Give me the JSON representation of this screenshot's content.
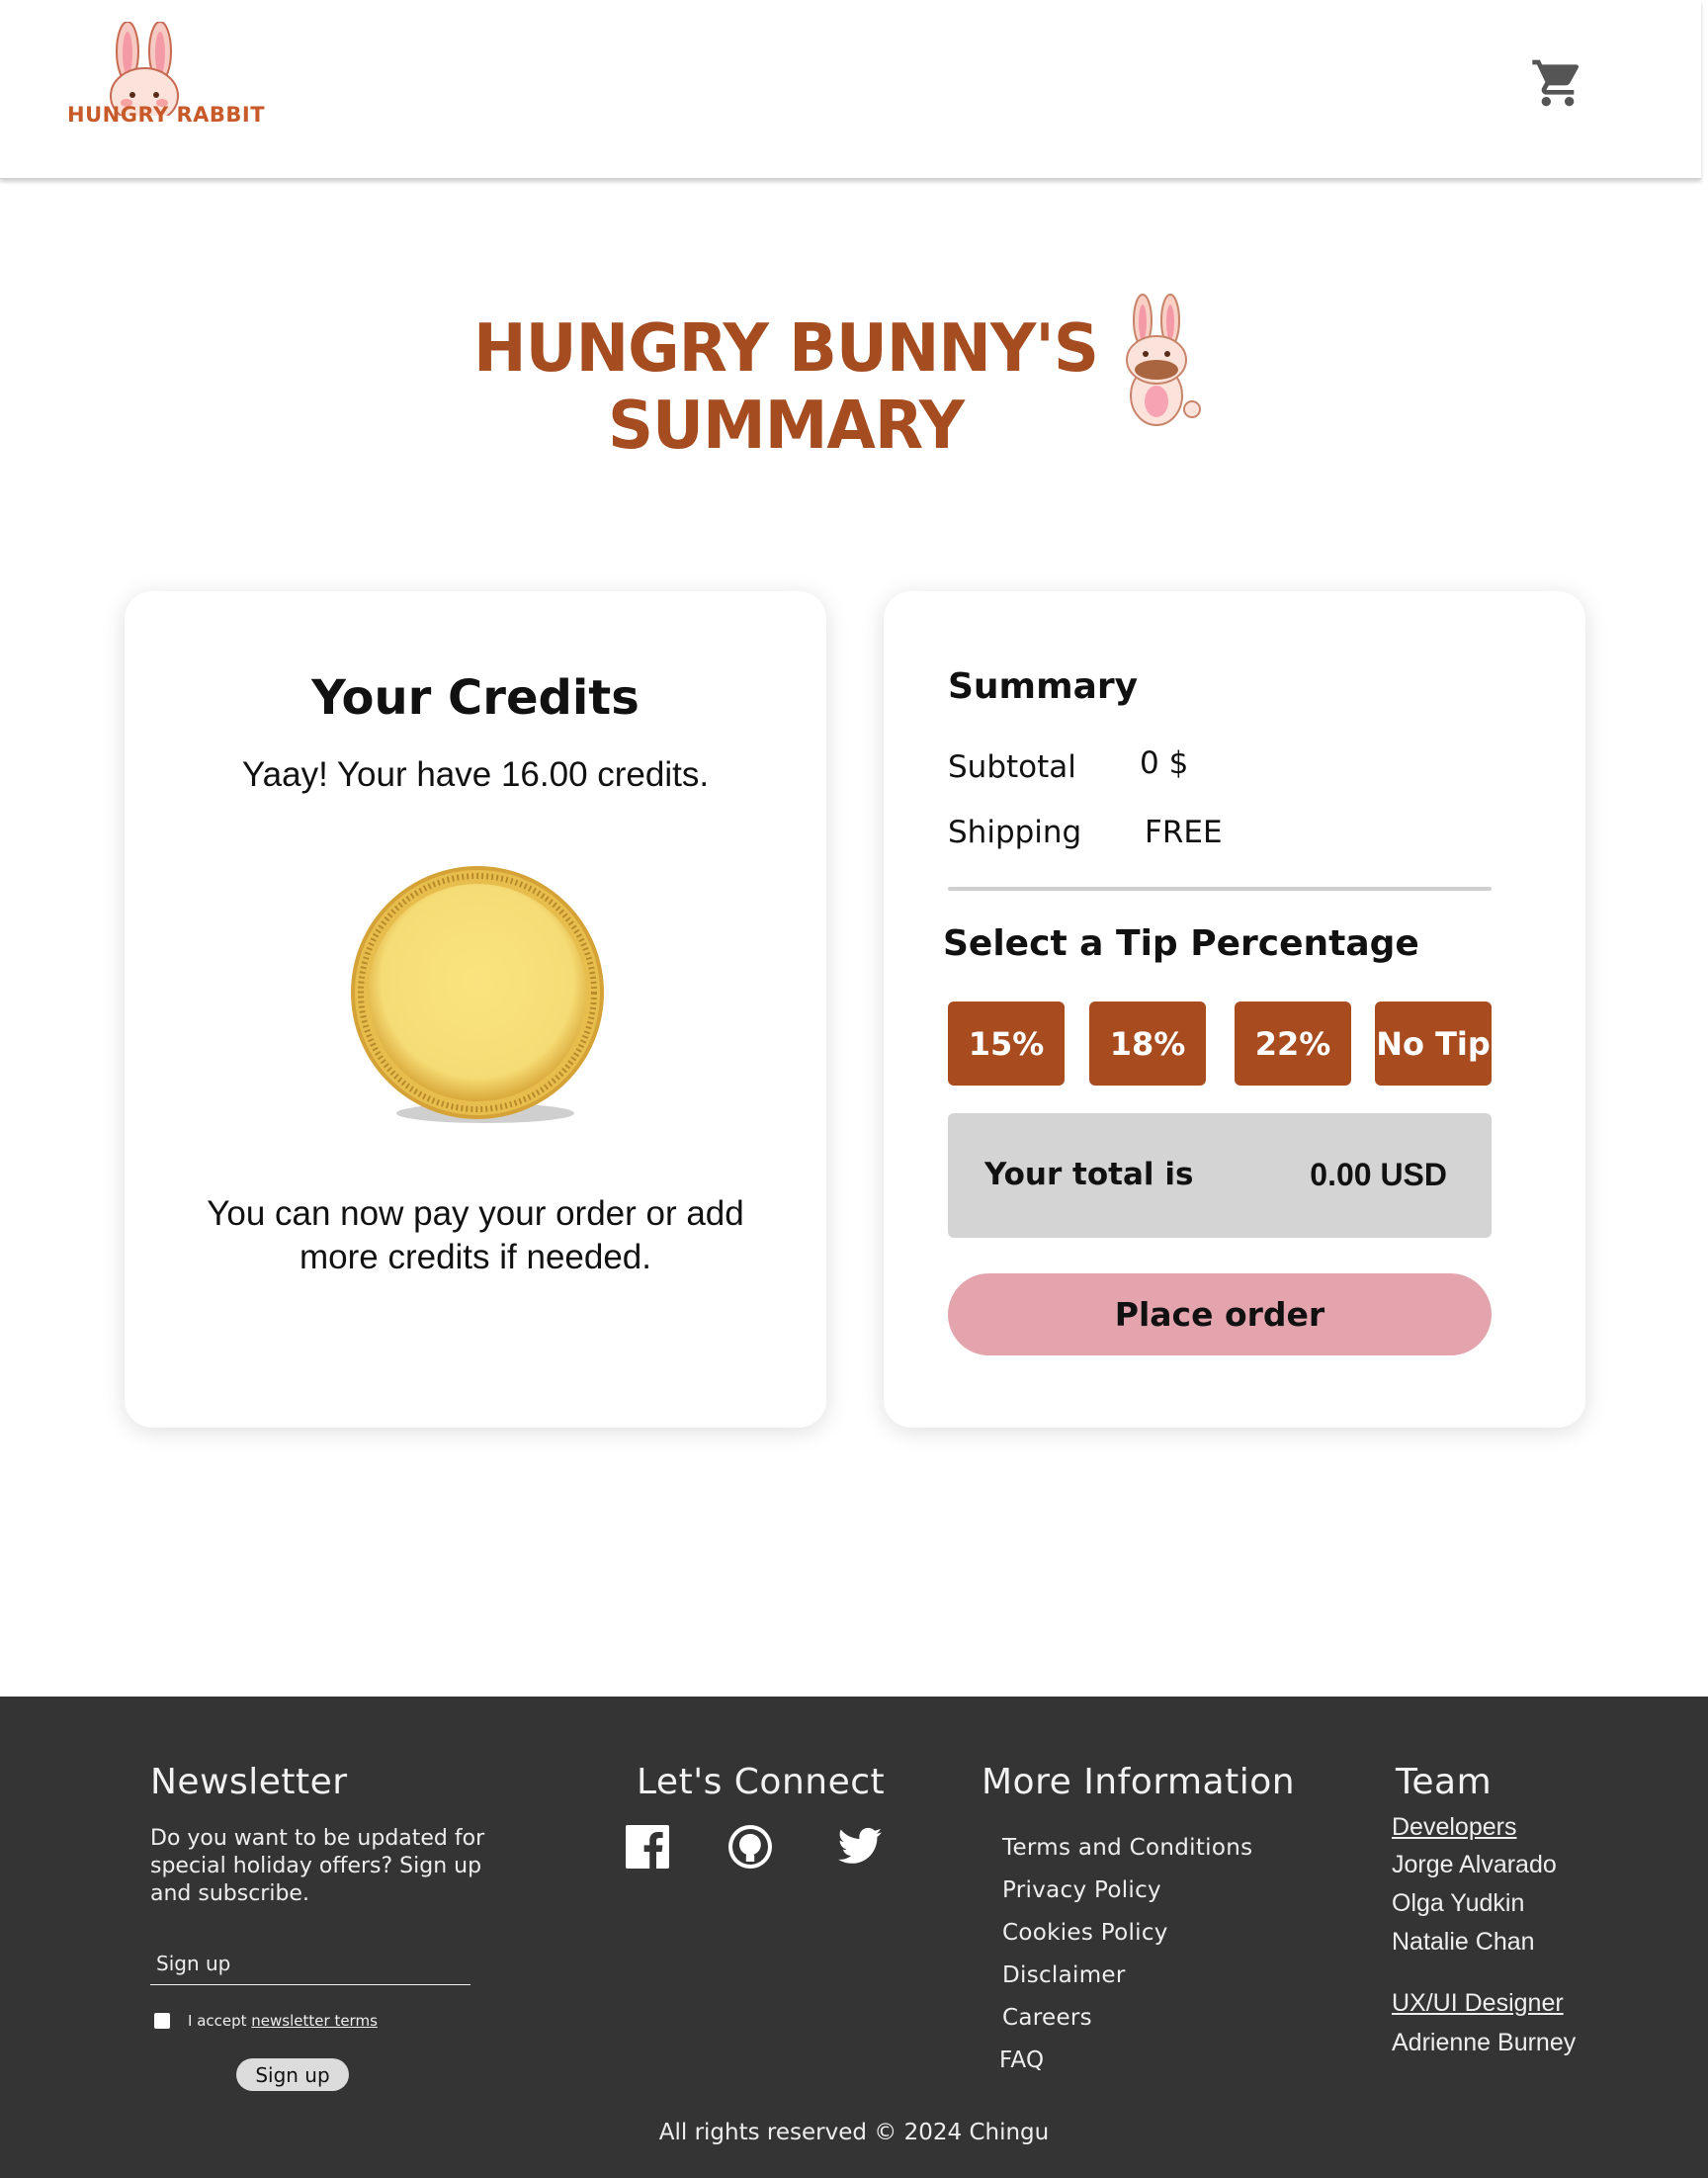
{
  "header": {
    "logo_text": "HUNGRY RABBIT",
    "cart_icon": "shopping-cart-icon"
  },
  "hero": {
    "title_line1": "HUNGRY BUNNY'S",
    "title_line2": "SUMMARY",
    "mascot_icon": "bunny-mascot-icon"
  },
  "credits": {
    "title": "Your Credits",
    "balance_text": "Yaay! Your have 16.00 credits.",
    "coin_icon": "gold-coin-icon",
    "note": "You can now pay your order or add more credits if needed."
  },
  "summary": {
    "title": "Summary",
    "subtotal_label": "Subtotal",
    "subtotal_value": "0 $",
    "shipping_label": "Shipping",
    "shipping_value": "FREE",
    "tip_title": "Select a Tip Percentage",
    "tips": [
      "15%",
      "18%",
      "22%",
      "No Tip"
    ],
    "total_label": "Your total is",
    "total_value": "0.00 USD",
    "place_order": "Place order"
  },
  "footer": {
    "newsletter": {
      "title": "Newsletter",
      "description": "Do you want to be updated for special holiday offers? Sign up and subscribe.",
      "input_placeholder": "Sign up",
      "accept_text": "I accept",
      "terms_link": "newsletter terms",
      "button": "Sign up"
    },
    "connect": {
      "title": "Let's Connect",
      "icons": [
        "facebook-icon",
        "github-icon",
        "twitter-icon"
      ]
    },
    "more_info": {
      "title": "More Information",
      "items": [
        "Terms and Conditions",
        "Privacy Policy",
        "Cookies Policy",
        "Disclaimer",
        "Careers",
        "FAQ"
      ]
    },
    "team": {
      "title": "Team",
      "developers_label": "Developers",
      "developers": [
        "Jorge Alvarado",
        "Olga Yudkin",
        "Natalie Chan"
      ],
      "designer_label": "UX/UI Designer",
      "designers": [
        "Adrienne Burney"
      ]
    },
    "copyright": "All rights reserved © 2024 Chingu"
  },
  "colors": {
    "brand_brown": "#a84c1f",
    "pink_button": "#e4a4ae",
    "footer_bg": "#343434",
    "total_bg": "#d4d4d4"
  }
}
